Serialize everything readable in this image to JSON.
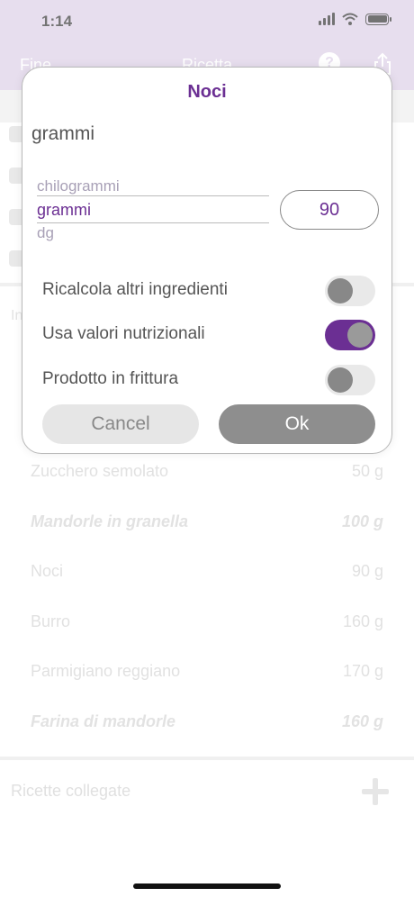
{
  "status": {
    "time": "1:14"
  },
  "nav": {
    "left_label": "Fine",
    "title": "Ricetta",
    "help_glyph": "?"
  },
  "background": {
    "section_label": "In",
    "ingredients": [
      {
        "name": "Zucchero semolato",
        "qty": "50 g",
        "bold": false
      },
      {
        "name": "Mandorle in granella",
        "qty": "100 g",
        "bold": true
      },
      {
        "name": "Noci",
        "qty": "90 g",
        "bold": false
      },
      {
        "name": "Burro",
        "qty": "160 g",
        "bold": false
      },
      {
        "name": "Parmigiano reggiano",
        "qty": "170 g",
        "bold": false
      },
      {
        "name": "Farina di mandorle",
        "qty": "160 g",
        "bold": true
      }
    ],
    "linked_recipes_label": "Ricette collegate"
  },
  "modal": {
    "title": "Noci",
    "unit_label": "grammi",
    "picker": {
      "above": "chilogrammi",
      "selected": "grammi",
      "below": "dg"
    },
    "quantity_value": "90",
    "options": [
      {
        "label": "Ricalcola altri ingredienti",
        "on": false
      },
      {
        "label": "Usa valori nutrizionali",
        "on": true
      },
      {
        "label": "Prodotto in frittura",
        "on": false
      }
    ],
    "cancel_label": "Cancel",
    "ok_label": "Ok"
  },
  "colors": {
    "accent": "#6b2f93",
    "header": "#d3c4e1"
  },
  "icons": [
    "wifi-icon",
    "battery-icon",
    "help-icon",
    "share-icon",
    "plus-icon"
  ]
}
